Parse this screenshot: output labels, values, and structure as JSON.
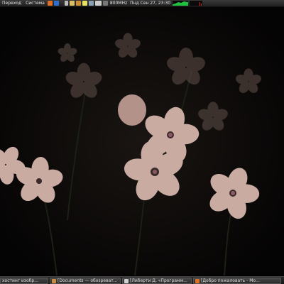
{
  "top_panel": {
    "menu_go": "Переход",
    "menu_system": "Система",
    "cpu_freq": "800MHz",
    "datetime": "Пнд Сен 27, 23:30",
    "tray_icons": [
      "firefox-icon",
      "bluetooth-icon",
      "terminal-icon",
      "volume-icon",
      "mail-icon",
      "folder-icon",
      "weather-icon",
      "battery-icon",
      "monitor-icon",
      "network-icon"
    ],
    "colors": {
      "panel_bg": "#2a2a2a",
      "graph_green": "#20c040",
      "graph_red": "#d02020"
    }
  },
  "taskbar": {
    "tasks": [
      {
        "label": "хостинг изобр..."
      },
      {
        "label": "[Documents — обозреват..."
      },
      {
        "label": "[Либерти Д. «Программ..."
      },
      {
        "label": "[Добро пожаловать - Мо..."
      }
    ]
  }
}
